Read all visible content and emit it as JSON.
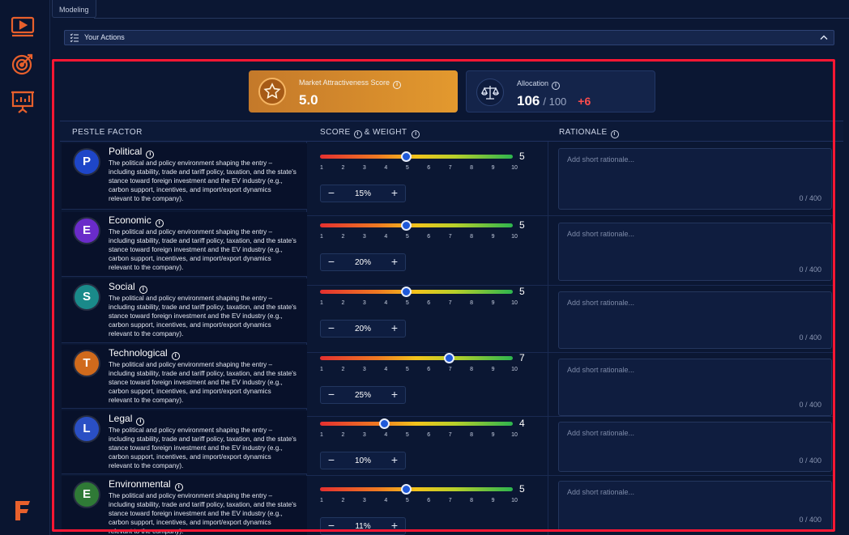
{
  "tabs": [
    "Modeling"
  ],
  "actions_bar": {
    "label": "Your Actions"
  },
  "market_score": {
    "label": "Market Attractiveness Score",
    "value": "5.0"
  },
  "allocation": {
    "label": "Allocation",
    "value": "106",
    "of": "/ 100",
    "delta": "+6"
  },
  "columns": {
    "factor": "PESTLE FACTOR",
    "score": "SCORE",
    "weight": "& WEIGHT",
    "rationale": "RATIONALE"
  },
  "ticks": [
    "1",
    "2",
    "3",
    "4",
    "5",
    "6",
    "7",
    "8",
    "9",
    "10"
  ],
  "rationale_placeholder": "Add short rationale...",
  "rationale_counter": "0 / 400",
  "factors": [
    {
      "letter": "P",
      "name": "Political",
      "color": "#1e46c8",
      "score": 5,
      "score_label": "5",
      "weight": "15%",
      "desc": "The political and policy environment shaping the entry – including stability, trade and tariff policy, taxation, and the state's stance toward foreign investment and the EV industry (e.g., carbon support, incentives, and import/export dynamics relevant to the company)."
    },
    {
      "letter": "E",
      "name": "Economic",
      "color": "#6a2bc9",
      "score": 5,
      "score_label": "5",
      "weight": "20%",
      "desc": "The political and policy environment shaping the entry – including stability, trade and tariff policy, taxation, and the state's stance toward foreign investment and the EV industry (e.g., carbon support, incentives, and import/export dynamics relevant to the company)."
    },
    {
      "letter": "S",
      "name": "Social",
      "color": "#1a8a8a",
      "score": 5,
      "score_label": "5",
      "weight": "20%",
      "desc": "The political and policy environment shaping the entry – including stability, trade and tariff policy, taxation, and the state's stance toward foreign investment and the EV industry (e.g., carbon support, incentives, and import/export dynamics relevant to the company)."
    },
    {
      "letter": "T",
      "name": "Technological",
      "color": "#d06a1c",
      "score": 7,
      "score_label": "7",
      "weight": "25%",
      "desc": "The political and policy environment shaping the entry – including stability, trade and tariff policy, taxation, and the state's stance toward foreign investment and the EV industry (e.g., carbon support, incentives, and import/export dynamics relevant to the company)."
    },
    {
      "letter": "L",
      "name": "Legal",
      "color": "#2a4fc4",
      "score": 4,
      "score_label": "4",
      "weight": "10%",
      "desc": "The political and policy environment shaping the entry – including stability, trade and tariff policy, taxation, and the state's stance toward foreign investment and the EV industry (e.g., carbon support, incentives, and import/export dynamics relevant to the company)."
    },
    {
      "letter": "E",
      "name": "Environmental",
      "color": "#2f7a36",
      "score": 5,
      "score_label": "5",
      "weight": "11%",
      "desc": "The political and policy environment shaping the entry – including stability, trade and tariff policy, taxation, and the state's stance toward foreign investment and the EV industry (e.g., carbon support, incentives, and import/export dynamics relevant to the company)."
    }
  ]
}
